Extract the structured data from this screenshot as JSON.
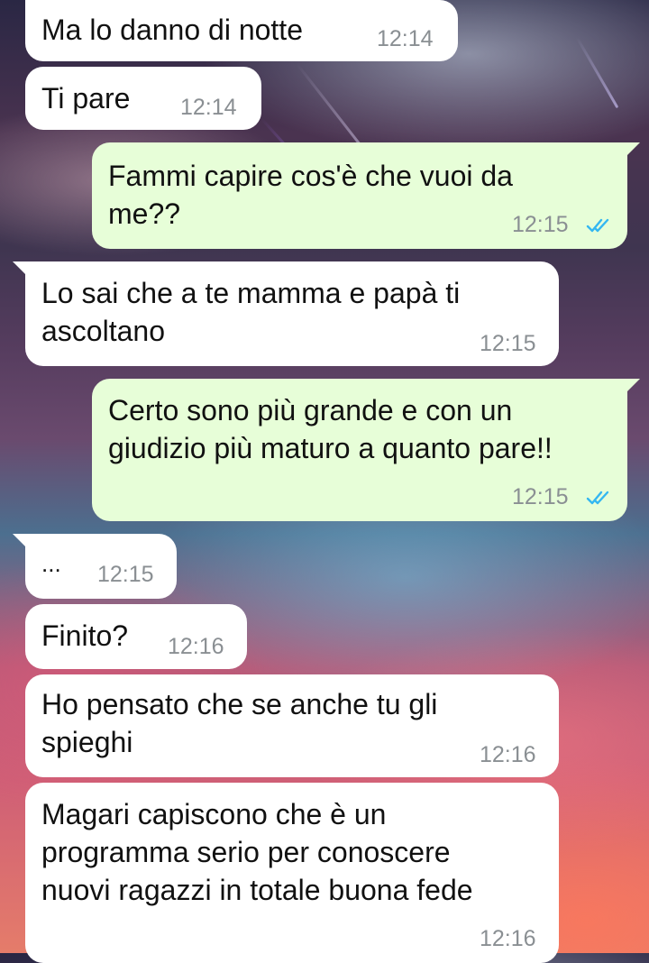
{
  "colors": {
    "incoming_bubble": "#ffffff",
    "outgoing_bubble": "#e7fed8",
    "timestamp": "#8a8f93",
    "read_ticks": "#34b7f1"
  },
  "icons": {
    "read_receipt": "double-check-icon"
  },
  "messages": [
    {
      "direction": "in",
      "lines": [
        "Ma lo danno di notte"
      ],
      "time": "12:14"
    },
    {
      "direction": "in",
      "lines": [
        "Ti pare"
      ],
      "time": "12:14"
    },
    {
      "direction": "out",
      "lines": [
        "Fammi capire cos'è che vuoi da",
        "me??"
      ],
      "time": "12:15",
      "read": true
    },
    {
      "direction": "in",
      "lines": [
        "Lo sai che a te mamma e papà ti",
        "ascoltano"
      ],
      "time": "12:15"
    },
    {
      "direction": "out",
      "lines": [
        "Certo sono più grande e con un",
        "giudizio più maturo a quanto pare!!"
      ],
      "time": "12:15",
      "read": true
    },
    {
      "direction": "in",
      "lines": [
        "..."
      ],
      "time": "12:15"
    },
    {
      "direction": "in",
      "lines": [
        "Finito?"
      ],
      "time": "12:16"
    },
    {
      "direction": "in",
      "lines": [
        "Ho pensato che se anche tu gli",
        "spieghi"
      ],
      "time": "12:16"
    },
    {
      "direction": "in",
      "lines": [
        "Magari capiscono che è un",
        "programma serio per conoscere",
        "nuovi ragazzi in totale buona fede"
      ],
      "time": "12:16"
    }
  ]
}
